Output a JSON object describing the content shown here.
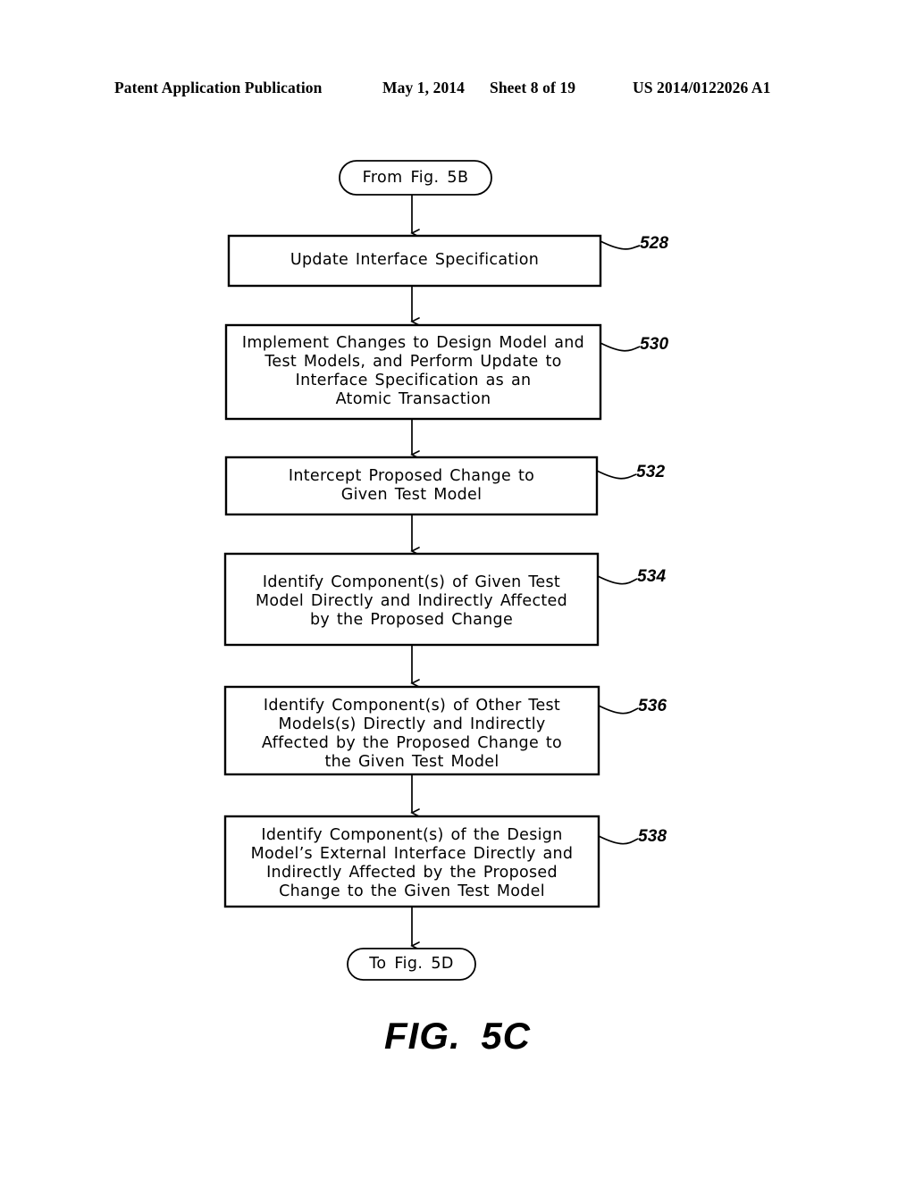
{
  "page_header": {
    "title": "Patent Application Publication",
    "date": "May 1, 2014",
    "sheet": "Sheet 8 of 19",
    "publication_number": "US 2014/0122026 A1"
  },
  "figure": {
    "caption": "FIG.  5C",
    "entry_terminal": {
      "label": "From  Fig.  5B",
      "shape": "stadium"
    },
    "exit_terminal": {
      "label": "To  Fig.  5D",
      "shape": "stadium"
    },
    "steps": [
      {
        "ref": "528",
        "text": "Update Interface Specification",
        "lines": [
          "Update Interface Specification"
        ]
      },
      {
        "ref": "530",
        "text": "Implement Changes to Design Model and Test Models, and Perform Update to Interface Specification as an Atomic Transaction",
        "lines": [
          "Implement Changes to Design Model and",
          "Test Models, and Perform Update to",
          "Interface Specification as an",
          "Atomic Transaction"
        ]
      },
      {
        "ref": "532",
        "text": "Intercept Proposed Change to Given Test Model",
        "lines": [
          "Intercept Proposed Change to",
          "Given Test Model"
        ]
      },
      {
        "ref": "534",
        "text": "Identify Component(s) of Given Test Model Directly and Indirectly Affected by the Proposed Change",
        "lines": [
          "Identify Component(s) of Given Test",
          "Model Directly and Indirectly Affected",
          "by the Proposed Change"
        ]
      },
      {
        "ref": "536",
        "text": "Identify Component(s) of Other Test Models(s) Directly and Indirectly Affected by the Proposed Change to the Given Test Model",
        "lines": [
          "Identify Component(s) of Other Test",
          "Models(s) Directly and Indirectly",
          "Affected by the Proposed Change to",
          "the Given Test Model"
        ]
      },
      {
        "ref": "538",
        "text": "Identify Component(s) of the Design Model's External Interface Directly and Indirectly Affected by the Proposed Change to the Given Test Model",
        "lines": [
          "Identify Component(s) of the Design",
          "Model’s External Interface Directly and",
          "Indirectly Affected by the Proposed",
          "Change to the Given Test Model"
        ]
      }
    ],
    "connector_count": 7,
    "colors": {
      "ink": "#000000",
      "background": "#ffffff"
    }
  }
}
